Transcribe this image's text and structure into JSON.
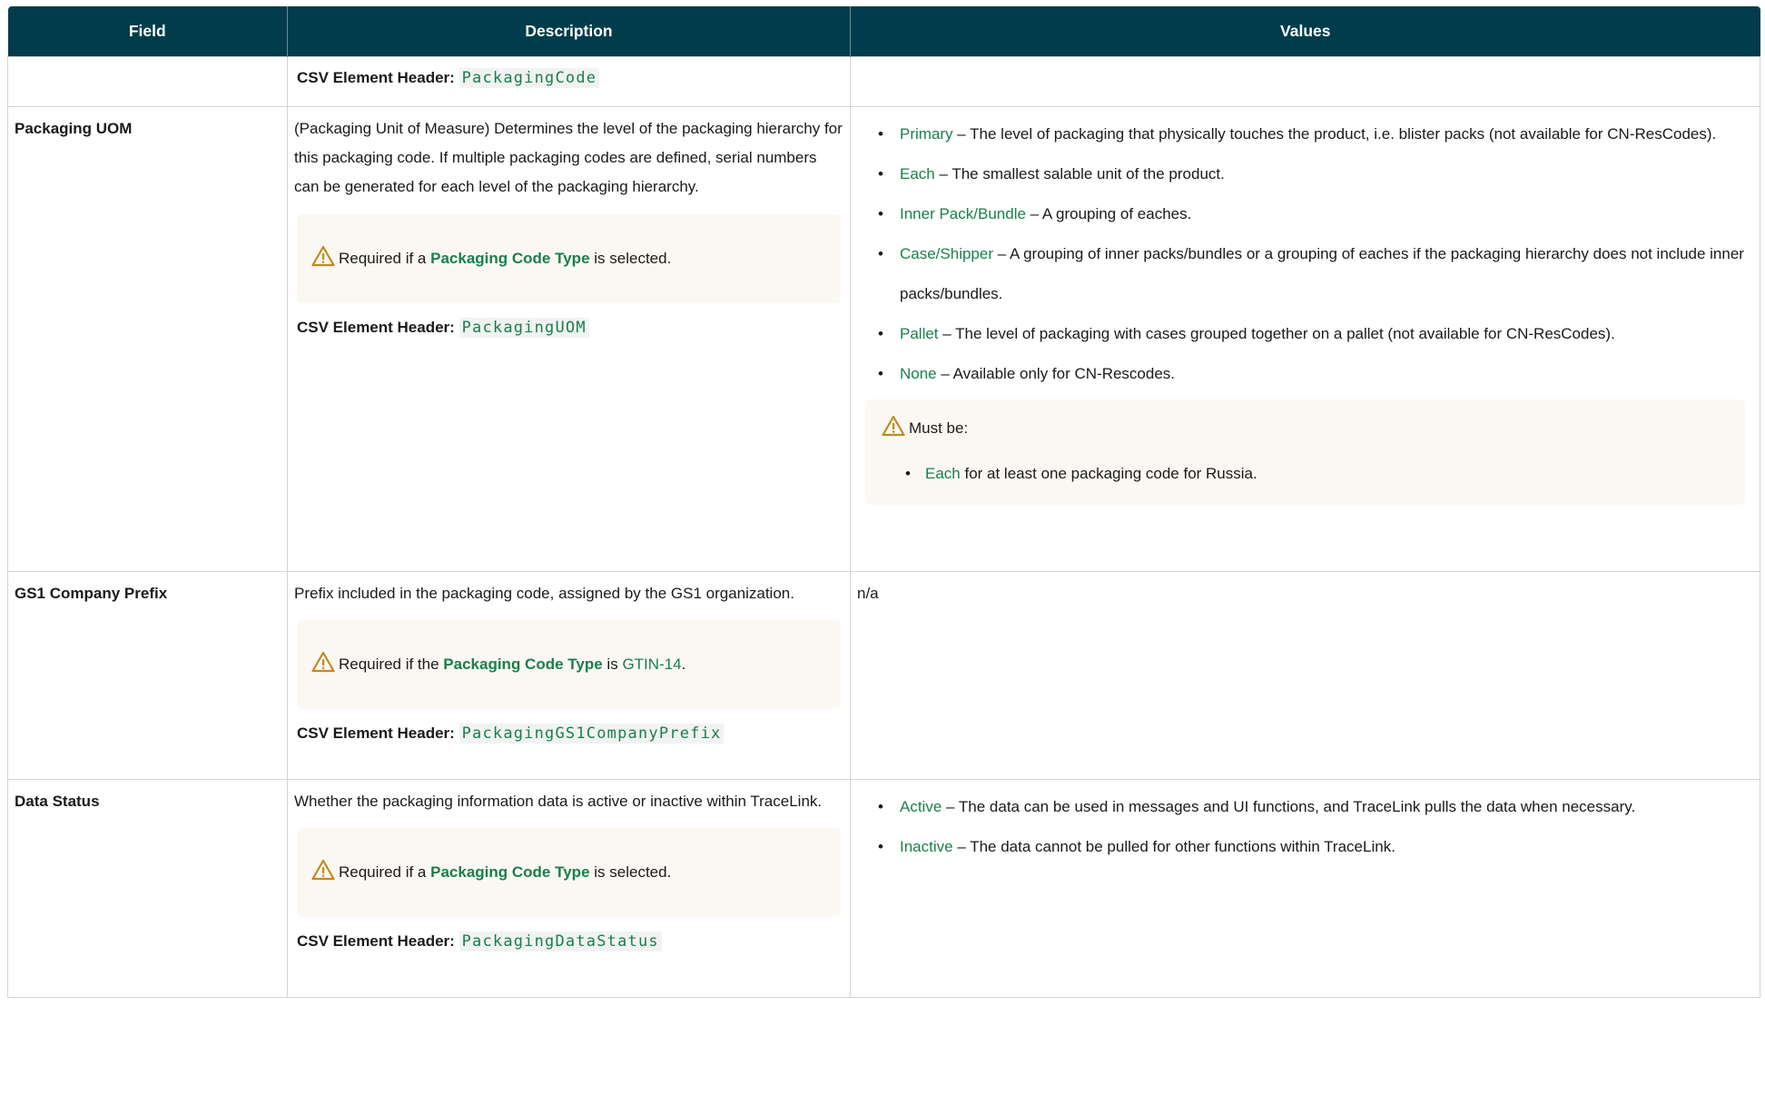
{
  "colors": {
    "header_bg": "#003c4b",
    "accent_green": "#1a7f4b",
    "callout_bg": "#fbf8f3",
    "warning_icon": "#c08a1e"
  },
  "table": {
    "headers": {
      "field": "Field",
      "description": "Description",
      "values": "Values"
    },
    "csv_label": "CSV Element Header:",
    "rows": {
      "packaging_code": {
        "field": "",
        "csv_value": "PackagingCode"
      },
      "packaging_uom": {
        "field": "Packaging UOM",
        "description": "(Packaging Unit of Measure) Determines the level of the packaging hierarchy for this packaging code. If multiple packaging codes are defined, serial numbers can be generated for each level of the packaging hierarchy.",
        "callout": {
          "pre": "Required if a ",
          "term": "Packaging Code Type",
          "post": " is selected."
        },
        "csv_value": "PackagingUOM",
        "values": [
          {
            "term": "Primary",
            "text": " – The level of packaging that physically touches the product, i.e. blister packs (not available for CN-ResCodes)."
          },
          {
            "term": "Each",
            "text": " – The smallest salable unit of the product."
          },
          {
            "term": "Inner Pack/Bundle",
            "text": " – A grouping of eaches."
          },
          {
            "term": "Case/Shipper",
            "text": " – A grouping of inner packs/bundles or a grouping of eaches if the packaging hierarchy does not include inner packs/bundles."
          },
          {
            "term": "Pallet",
            "text": " – The level of packaging with cases grouped together on a pallet (not available for CN-ResCodes)."
          },
          {
            "term": "None",
            "text": " – Available only for CN-Rescodes."
          }
        ],
        "values_callout": {
          "head": "Must be:",
          "item_term": "Each",
          "item_text": " for at least one packaging code for Russia."
        }
      },
      "gs1_prefix": {
        "field": "GS1 Company Prefix",
        "description": "Prefix included in the packaging code, assigned by the GS1 organization.",
        "callout": {
          "pre": "Required if the ",
          "term": "Packaging Code Type",
          "mid": " is ",
          "value": "GTIN-14",
          "post": "."
        },
        "csv_value": "PackagingGS1CompanyPrefix",
        "values_text": "n/a"
      },
      "data_status": {
        "field": "Data Status",
        "description": "Whether the packaging information data is active or inactive within TraceLink.",
        "callout": {
          "pre": "Required if a ",
          "term": "Packaging Code Type",
          "post": " is selected."
        },
        "csv_value": "PackagingDataStatus",
        "values": [
          {
            "term": "Active",
            "text": " – The data can be used in messages and UI functions, and TraceLink pulls the data when necessary."
          },
          {
            "term": "Inactive",
            "text": " – The data cannot be pulled for other functions within TraceLink."
          }
        ]
      }
    }
  }
}
